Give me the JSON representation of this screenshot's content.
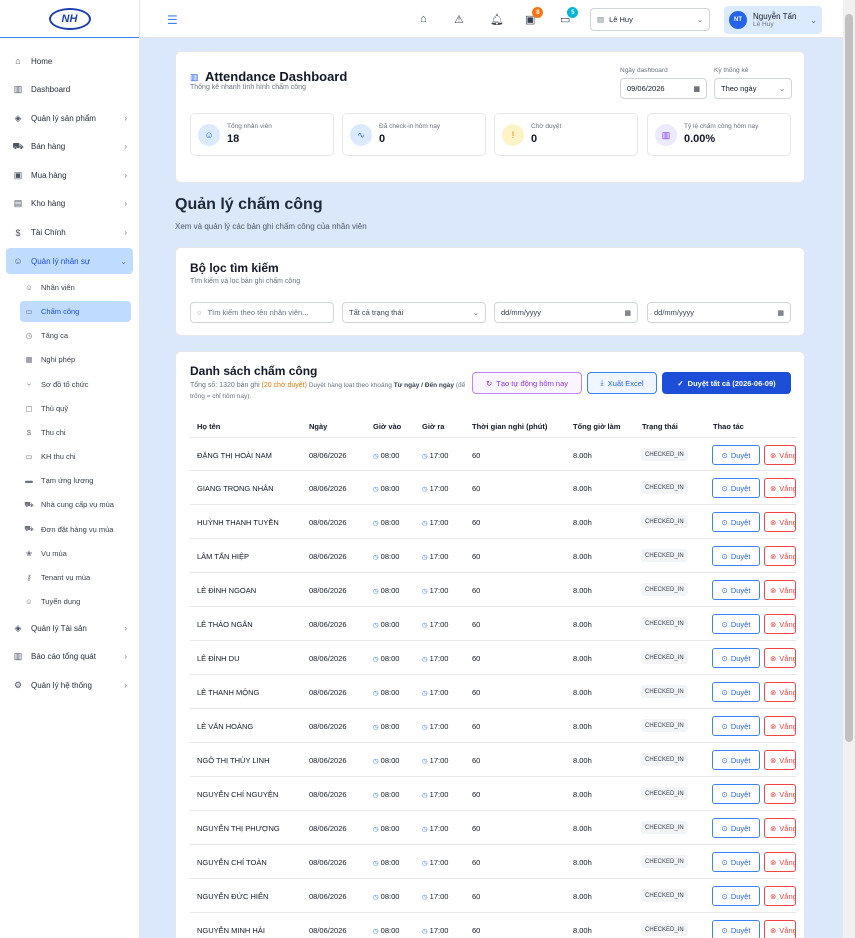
{
  "sidebar": {
    "logo_text": "NH",
    "items": [
      {
        "label": "Home",
        "icon": "home-icon",
        "glyph": "⌂",
        "chevron": false
      },
      {
        "label": "Dashboard",
        "icon": "bar-chart-icon",
        "glyph": "▥",
        "chevron": false
      },
      {
        "label": "Quản lý sản phẩm",
        "icon": "box-icon",
        "glyph": "◈",
        "chevron": true
      },
      {
        "label": "Bán hàng",
        "icon": "cart-icon",
        "glyph": "⛟",
        "chevron": true
      },
      {
        "label": "Mua hàng",
        "icon": "shop-icon",
        "glyph": "▣",
        "chevron": true
      },
      {
        "label": "Kho hàng",
        "icon": "warehouse-icon",
        "glyph": "▤",
        "chevron": true
      },
      {
        "label": "Tài Chính",
        "icon": "dollar-icon",
        "glyph": "$",
        "chevron": true
      },
      {
        "label": "Quản lý nhân sự",
        "icon": "users-icon",
        "glyph": "☺",
        "chevron": true,
        "active": true
      }
    ],
    "sub_items": [
      {
        "label": "Nhân viên",
        "icon": "users-icon",
        "glyph": "☺"
      },
      {
        "label": "Chấm công",
        "icon": "file-icon",
        "glyph": "▭",
        "active": true
      },
      {
        "label": "Tăng ca",
        "icon": "clock-icon",
        "glyph": "◷"
      },
      {
        "label": "Nghỉ phép",
        "icon": "calendar-icon",
        "glyph": "▦"
      },
      {
        "label": "Sơ đồ tổ chức",
        "icon": "git-branch-icon",
        "glyph": "⑂"
      },
      {
        "label": "Thủ quỹ",
        "icon": "wallet-icon",
        "glyph": "▢"
      },
      {
        "label": "Thu chi",
        "icon": "dollar-icon",
        "glyph": "$"
      },
      {
        "label": "KH thu chi",
        "icon": "file-icon",
        "glyph": "▭"
      },
      {
        "label": "Tạm ứng lương",
        "icon": "card-icon",
        "glyph": "▬"
      },
      {
        "label": "Nhà cung cấp vụ mùa",
        "icon": "truck-icon",
        "glyph": "⛟"
      },
      {
        "label": "Đơn đặt hàng vụ mùa",
        "icon": "cart-icon",
        "glyph": "⛟"
      },
      {
        "label": "Vụ mùa",
        "icon": "leaf-icon",
        "glyph": "❀"
      },
      {
        "label": "Tenant vụ mùa",
        "icon": "key-icon",
        "glyph": "⚷"
      },
      {
        "label": "Tuyển dụng",
        "icon": "user-plus-icon",
        "glyph": "☺"
      }
    ],
    "bottom_items": [
      {
        "label": "Quản lý Tài sản",
        "icon": "box-icon",
        "glyph": "◈",
        "chevron": true
      },
      {
        "label": "Báo cáo tổng quát",
        "icon": "bar-chart-icon",
        "glyph": "▥",
        "chevron": true
      },
      {
        "label": "Quản lý hệ thống",
        "icon": "gear-icon",
        "glyph": "⚙",
        "chevron": true
      }
    ]
  },
  "topbar": {
    "badge_gift": "8",
    "badge_chat": "5",
    "branch": "Lê Huy",
    "user_initials": "NT",
    "user_name": "Nguyễn Tấn",
    "user_sub": "Lê Huy"
  },
  "dashboard": {
    "title": "Attendance Dashboard",
    "subtitle": "Thống kê nhanh tình hình chấm công",
    "date_label": "Ngày dashboard",
    "date_value": "09/06/2026",
    "period_label": "Kỳ thống kê",
    "period_value": "Theo ngày",
    "stats": [
      {
        "label": "Tổng nhân viên",
        "value": "18",
        "icon": "users-icon",
        "glyph": "☺",
        "bg": "#dbeafe",
        "fg": "#2563eb"
      },
      {
        "label": "Đã check-in hôm nay",
        "value": "0",
        "icon": "activity-icon",
        "glyph": "∿",
        "bg": "#dbeafe",
        "fg": "#2563eb"
      },
      {
        "label": "Chờ duyệt",
        "value": "0",
        "icon": "alert-circle-icon",
        "glyph": "!",
        "bg": "#fef3c7",
        "fg": "#d97706"
      },
      {
        "label": "Tỷ lệ chấm công hôm nay",
        "value": "0.00%",
        "icon": "bar-chart-icon",
        "glyph": "▥",
        "bg": "#ede9fe",
        "fg": "#7c3aed"
      }
    ]
  },
  "page": {
    "title": "Quản lý chấm công",
    "subtitle": "Xem và quản lý các bản ghi chấm công của nhân viên"
  },
  "filter": {
    "title": "Bộ lọc tìm kiếm",
    "subtitle": "Tìm kiếm và lọc bản ghi chấm công",
    "search_placeholder": "Tìm kiếm theo tên nhân viên...",
    "status_value": "Tất cả trạng thái",
    "from_date": "dd/mm/yyyy",
    "to_date": "dd/mm/yyyy"
  },
  "list": {
    "title": "Danh sách chấm công",
    "total_text": "Tổng số: 1320 bản ghi",
    "pending_text": "(20 chờ duyệt)",
    "hint_a": "Duyệt hàng loạt theo khoảng",
    "hint_b": "Từ ngày / Đến",
    "hint_c": "ngày",
    "hint_d": "(để trống = chỉ hôm nay).",
    "btn_auto": "Tạo tự động hôm nay",
    "btn_export": "Xuất Excel",
    "btn_approve_all": "Duyệt tất cả (2026-06-09)",
    "headers": [
      "Họ tên",
      "Ngày",
      "Giờ vào",
      "Giờ ra",
      "Thời gian nghỉ (phút)",
      "Tổng giờ làm",
      "Trạng thái",
      "Thao tác"
    ],
    "approve_label": "Duyệt",
    "reject_label": "Vắng",
    "rows": [
      {
        "name": "ĐẶNG THỊ HOÀI NAM",
        "date": "08/06/2026",
        "in": "08:00",
        "out": "17:00",
        "break": "60",
        "total": "8.00h",
        "status": "CHECKED_IN"
      },
      {
        "name": "GIANG TRỌNG NHÂN",
        "date": "08/06/2026",
        "in": "08:00",
        "out": "17:00",
        "break": "60",
        "total": "8.00h",
        "status": "CHECKED_IN"
      },
      {
        "name": "HUỲNH THANH TUYỀN",
        "date": "08/06/2026",
        "in": "08:00",
        "out": "17:00",
        "break": "60",
        "total": "8.00h",
        "status": "CHECKED_IN"
      },
      {
        "name": "LÂM TẤN HIỆP",
        "date": "08/06/2026",
        "in": "08:00",
        "out": "17:00",
        "break": "60",
        "total": "8.00h",
        "status": "CHECKED_IN"
      },
      {
        "name": "LÊ ĐÌNH NGOẠN",
        "date": "08/06/2026",
        "in": "08:00",
        "out": "17:00",
        "break": "60",
        "total": "8.00h",
        "status": "CHECKED_IN"
      },
      {
        "name": "LÊ THẢO NGÂN",
        "date": "08/06/2026",
        "in": "08:00",
        "out": "17:00",
        "break": "60",
        "total": "8.00h",
        "status": "CHECKED_IN"
      },
      {
        "name": "LÊ ĐÌNH DU",
        "date": "08/06/2026",
        "in": "08:00",
        "out": "17:00",
        "break": "60",
        "total": "8.00h",
        "status": "CHECKED_IN"
      },
      {
        "name": "LÊ THANH MỘNG",
        "date": "08/06/2026",
        "in": "08:00",
        "out": "17:00",
        "break": "60",
        "total": "8.00h",
        "status": "CHECKED_IN"
      },
      {
        "name": "LÊ VĂN HOÀNG",
        "date": "08/06/2026",
        "in": "08:00",
        "out": "17:00",
        "break": "60",
        "total": "8.00h",
        "status": "CHECKED_IN"
      },
      {
        "name": "NGÔ THỊ THÙY LINH",
        "date": "08/06/2026",
        "in": "08:00",
        "out": "17:00",
        "break": "60",
        "total": "8.00h",
        "status": "CHECKED_IN"
      },
      {
        "name": "NGUYỄN CHÍ NGUYỆN",
        "date": "08/06/2026",
        "in": "08:00",
        "out": "17:00",
        "break": "60",
        "total": "8.00h",
        "status": "CHECKED_IN"
      },
      {
        "name": "NGUYỄN THỊ PHƯỢNG",
        "date": "08/06/2026",
        "in": "08:00",
        "out": "17:00",
        "break": "60",
        "total": "8.00h",
        "status": "CHECKED_IN"
      },
      {
        "name": "NGUYỄN CHÍ TOÀN",
        "date": "08/06/2026",
        "in": "08:00",
        "out": "17:00",
        "break": "60",
        "total": "8.00h",
        "status": "CHECKED_IN"
      },
      {
        "name": "NGUYỄN ĐỨC HIỂN",
        "date": "08/06/2026",
        "in": "08:00",
        "out": "17:00",
        "break": "60",
        "total": "8.00h",
        "status": "CHECKED_IN"
      },
      {
        "name": "NGUYỄN MINH HẢI",
        "date": "08/06/2026",
        "in": "08:00",
        "out": "17:00",
        "break": "60",
        "total": "8.00h",
        "status": "CHECKED_IN"
      }
    ]
  }
}
